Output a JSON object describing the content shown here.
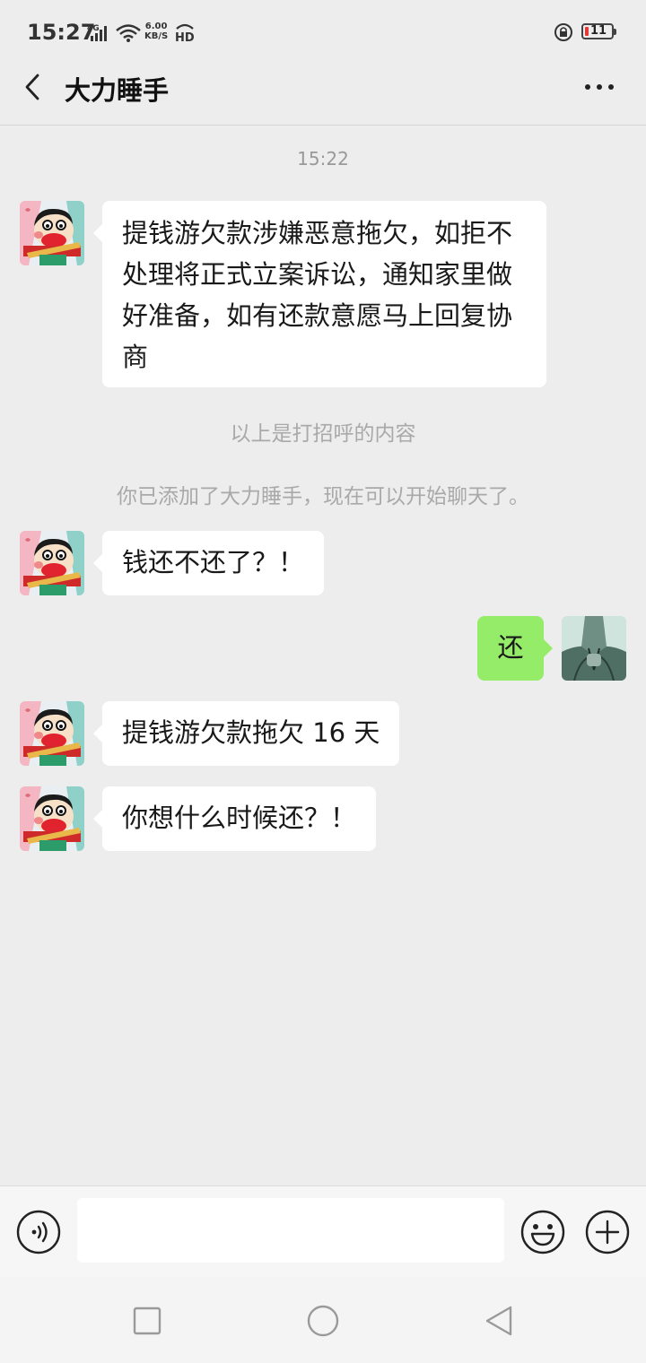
{
  "status_bar": {
    "time": "15:27",
    "network": "4G",
    "speed_value": "6.00",
    "speed_unit": "KB/S",
    "hd": "HD",
    "battery": "11"
  },
  "header": {
    "title": "大力睡手",
    "back_icon": "chevron-left-icon",
    "more_icon": "more-dots-icon"
  },
  "messages": {
    "timestamp": "15:22",
    "m1": "提钱游欠款涉嫌恶意拖欠，如拒不处理将正式立案诉讼，通知家里做好准备，如有还款意愿马上回复协商",
    "sys1": "以上是打招呼的内容",
    "sys2": "你已添加了大力睡手，现在可以开始聊天了。",
    "m2": "钱还不还了？！",
    "m3": "还",
    "m4": "提钱游欠款拖欠 16 天",
    "m5": "你想什么时候还？！"
  },
  "input_bar": {
    "value": "",
    "voice_icon": "voice-icon",
    "emoji_icon": "emoji-icon",
    "plus_icon": "plus-icon"
  },
  "nav": {
    "recents_icon": "square-icon",
    "home_icon": "circle-icon",
    "back_icon": "triangle-back-icon"
  },
  "colors": {
    "background": "#ededed",
    "bubble_in": "#ffffff",
    "bubble_out": "#95ec69",
    "battery_low": "#e53935"
  }
}
